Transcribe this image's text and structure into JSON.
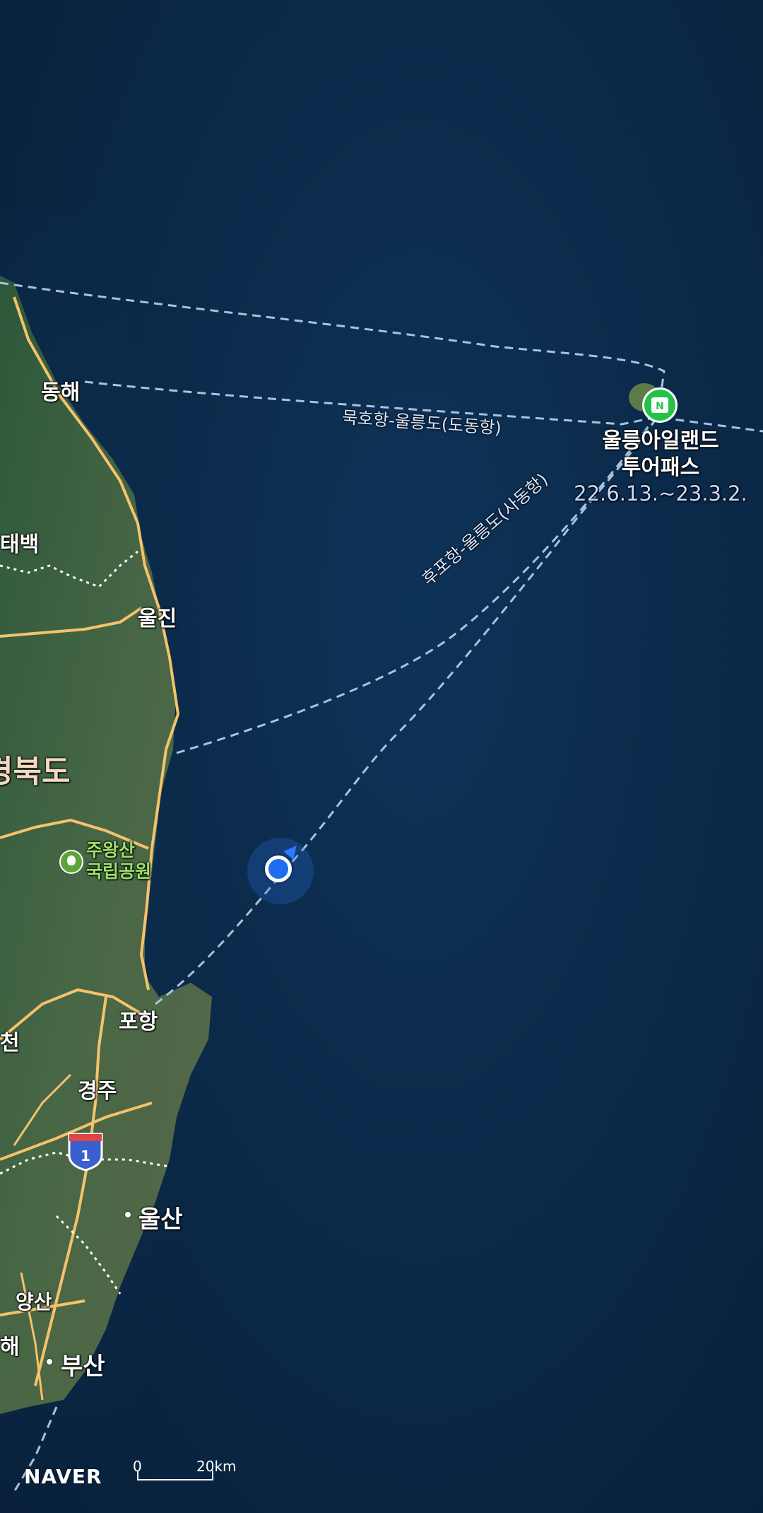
{
  "map": {
    "brand": "NAVER",
    "scale": {
      "zero": "0",
      "distance": "20km"
    },
    "colors": {
      "sea": "#0b2a4a",
      "land": "#3a5a3a",
      "road": "#f5c26b",
      "route": "#8fb0d8",
      "poi_green": "#24c24a",
      "location": "#1e6cf0"
    }
  },
  "places": {
    "donghae": "동해",
    "taebaek": "태백",
    "uljin": "울진",
    "region_gyeongbuk": "경북도",
    "pohang": "포항",
    "gyeongju": "경주",
    "ulsan": "울산",
    "yangsan": "양산",
    "busan": "부산",
    "yeongcheon": "천",
    "gimhae": "해"
  },
  "park": {
    "line1": "주왕산",
    "line2": "국립공원",
    "icon": "park-tree-icon"
  },
  "poi": {
    "line1": "울릉아일랜드",
    "line2": "투어패스",
    "dates": "22.6.13.~23.3.2.",
    "icon": "calendar-icon",
    "icon_letter": "N"
  },
  "routes": {
    "mukho": "묵호항-울릉도(도동항)",
    "hupo": "후포항-울릉도(사동항)"
  },
  "highway": {
    "number": "1"
  }
}
